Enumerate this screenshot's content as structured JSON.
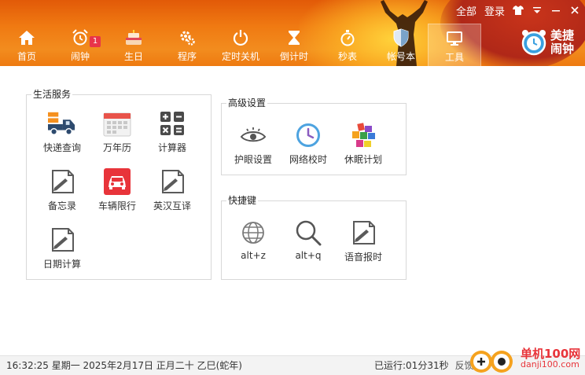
{
  "header": {
    "top_links": {
      "all": "全部",
      "login": "登录"
    },
    "nav": [
      {
        "label": "首页",
        "icon": "home-icon"
      },
      {
        "label": "闹钟",
        "icon": "alarm-clock-icon",
        "badge": "1"
      },
      {
        "label": "生日",
        "icon": "cake-icon"
      },
      {
        "label": "程序",
        "icon": "gears-icon"
      },
      {
        "label": "定时关机",
        "icon": "power-icon"
      },
      {
        "label": "倒计时",
        "icon": "hourglass-icon"
      },
      {
        "label": "秒表",
        "icon": "stopwatch-icon"
      },
      {
        "label": "帐号本",
        "icon": "shield-icon"
      },
      {
        "label": "工具",
        "icon": "monitor-icon",
        "active": true
      }
    ],
    "brand": "美捷闹钟"
  },
  "life_services": {
    "title": "生活服务",
    "items": [
      {
        "label": "快递查询",
        "icon": "delivery-truck-icon"
      },
      {
        "label": "万年历",
        "icon": "calendar-icon"
      },
      {
        "label": "计算器",
        "icon": "calculator-icon"
      },
      {
        "label": "备忘录",
        "icon": "memo-pen-icon"
      },
      {
        "label": "车辆限行",
        "icon": "car-icon"
      },
      {
        "label": "英汉互译",
        "icon": "translate-pen-icon"
      },
      {
        "label": "日期计算",
        "icon": "date-pen-icon"
      }
    ]
  },
  "advanced": {
    "title": "高级设置",
    "items": [
      {
        "label": "护眼设置",
        "icon": "eye-icon"
      },
      {
        "label": "网络校时",
        "icon": "clock-icon"
      },
      {
        "label": "休眠计划",
        "icon": "colorful-blocks-icon"
      }
    ]
  },
  "shortcuts": {
    "title": "快捷键",
    "items": [
      {
        "label": "alt+z",
        "icon": "globe-icon"
      },
      {
        "label": "alt+q",
        "icon": "magnifier-icon"
      },
      {
        "label": "语音报时",
        "icon": "voice-pen-icon"
      }
    ]
  },
  "status": {
    "datetime": "16:32:25 星期一 2025年2月17日 正月二十 乙巳(蛇年)",
    "running": "已运行:01分31秒",
    "feedback": "反馈"
  },
  "watermark": {
    "text": "单机100网",
    "sub": "danji100.com"
  },
  "colors": {
    "header_orange": "#f07a12",
    "accent_red": "#e8343a",
    "badge_red": "#e8344a"
  }
}
